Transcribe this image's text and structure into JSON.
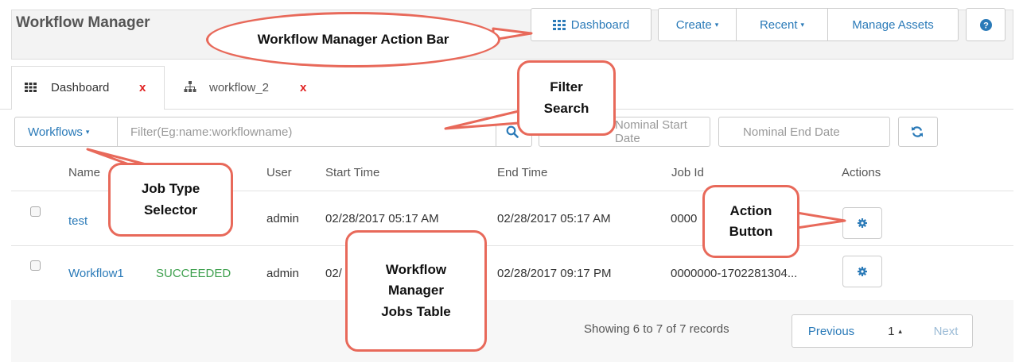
{
  "header": {
    "title": "Workflow Manager",
    "buttons": {
      "dashboard": "Dashboard",
      "create": "Create",
      "recent": "Recent",
      "manage_assets": "Manage Assets"
    }
  },
  "tabs": [
    {
      "label": "Dashboard",
      "close": "x"
    },
    {
      "label": "workflow_2",
      "close": "x"
    }
  ],
  "filter": {
    "type_selector": "Workflows",
    "search_placeholder": "Filter(Eg:name:workflowname)",
    "nominal_start_placeholder": "Nominal Start Date",
    "nominal_end_placeholder": "Nominal End Date"
  },
  "table": {
    "columns": [
      "Name",
      "User",
      "Start Time",
      "End Time",
      "Job Id",
      "Actions"
    ],
    "rows": [
      {
        "name": "test",
        "status": "",
        "user": "admin",
        "start": "02/28/2017 05:17 AM",
        "end": "02/28/2017 05:17 AM",
        "job_id": "0000"
      },
      {
        "name": "Workflow1",
        "status": "SUCCEEDED",
        "user": "admin",
        "start": "02/",
        "end": "02/28/2017 09:17 PM",
        "job_id": "0000000-1702281304..."
      }
    ]
  },
  "footer": {
    "records": "Showing 6 to 7 of 7 records",
    "previous": "Previous",
    "page": "1",
    "next": "Next"
  },
  "callouts": {
    "action_bar": "Workflow Manager Action Bar",
    "filter_search_1": "Filter",
    "filter_search_2": "Search",
    "job_type_1": "Job Type",
    "job_type_2": "Selector",
    "action_button_1": "Action",
    "action_button_2": "Button",
    "jobs_table_1": "Workflow",
    "jobs_table_2": "Manager",
    "jobs_table_3": "Jobs Table"
  },
  "icons": {
    "dashboard": "grid-icon",
    "workflow": "hierarchy-icon",
    "search": "search-icon",
    "refresh": "refresh-icon",
    "help": "help-icon",
    "action": "gear-icon"
  },
  "colors": {
    "link": "#2a7ab8",
    "success": "#3ea04e",
    "close": "#e02020",
    "callout_border": "#e8695a"
  }
}
